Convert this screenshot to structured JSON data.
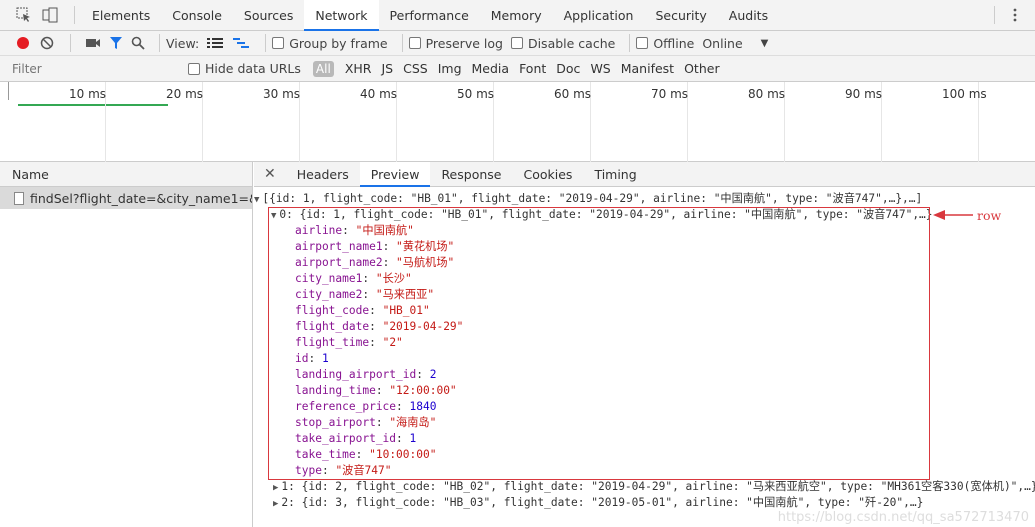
{
  "devtools": {
    "tabs": [
      "Elements",
      "Console",
      "Sources",
      "Network",
      "Performance",
      "Memory",
      "Application",
      "Security",
      "Audits"
    ],
    "active_tab": "Network"
  },
  "toolbar": {
    "view_label": "View:",
    "group_by_frame": "Group by frame",
    "preserve_log": "Preserve log",
    "disable_cache": "Disable cache",
    "offline": "Offline",
    "throttle_value": "Online"
  },
  "filter": {
    "placeholder": "Filter",
    "hide_data_urls": "Hide data URLs",
    "all": "All",
    "types": [
      "XHR",
      "JS",
      "CSS",
      "Img",
      "Media",
      "Font",
      "Doc",
      "WS",
      "Manifest",
      "Other"
    ]
  },
  "timeline": {
    "ticks": [
      "10 ms",
      "20 ms",
      "30 ms",
      "40 ms",
      "50 ms",
      "60 ms",
      "70 ms",
      "80 ms",
      "90 ms",
      "100 ms"
    ]
  },
  "requests": {
    "header": "Name",
    "items": [
      "findSel?flight_date=&city_name1=&cit..."
    ]
  },
  "detail": {
    "tabs": [
      "Headers",
      "Preview",
      "Response",
      "Cookies",
      "Timing"
    ],
    "active_tab": "Preview"
  },
  "preview": {
    "root_line": "[{id: 1, flight_code: \"HB_01\", flight_date: \"2019-04-29\", airline: \"中国南航\", type: \"波音747\",…},…]",
    "item0_summary": "0: {id: 1, flight_code: \"HB_01\", flight_date: \"2019-04-29\", airline: \"中国南航\", type: \"波音747\",…}",
    "fields": [
      {
        "key": "airline",
        "value": "\"中国南航\"",
        "kind": "s"
      },
      {
        "key": "airport_name1",
        "value": "\"黄花机场\"",
        "kind": "s"
      },
      {
        "key": "airport_name2",
        "value": "\"马航机场\"",
        "kind": "s"
      },
      {
        "key": "city_name1",
        "value": "\"长沙\"",
        "kind": "s"
      },
      {
        "key": "city_name2",
        "value": "\"马来西亚\"",
        "kind": "s"
      },
      {
        "key": "flight_code",
        "value": "\"HB_01\"",
        "kind": "s"
      },
      {
        "key": "flight_date",
        "value": "\"2019-04-29\"",
        "kind": "s"
      },
      {
        "key": "flight_time",
        "value": "\"2\"",
        "kind": "s"
      },
      {
        "key": "id",
        "value": "1",
        "kind": "n"
      },
      {
        "key": "landing_airport_id",
        "value": "2",
        "kind": "n"
      },
      {
        "key": "landing_time",
        "value": "\"12:00:00\"",
        "kind": "s"
      },
      {
        "key": "reference_price",
        "value": "1840",
        "kind": "n"
      },
      {
        "key": "stop_airport",
        "value": "\"海南岛\"",
        "kind": "s"
      },
      {
        "key": "take_airport_id",
        "value": "1",
        "kind": "n"
      },
      {
        "key": "take_time",
        "value": "\"10:00:00\"",
        "kind": "s"
      },
      {
        "key": "type",
        "value": "\"波音747\"",
        "kind": "s"
      }
    ],
    "item1_summary": "1: {id: 2, flight_code: \"HB_02\", flight_date: \"2019-04-29\", airline: \"马来西亚航空\", type: \"MH361空客330(宽体机)\",…}",
    "item2_summary": "2: {id: 3, flight_code: \"HB_03\", flight_date: \"2019-05-01\", airline: \"中国南航\", type: \"歼-20\",…}",
    "annotation_label": "row",
    "accent_color": "#d9383e"
  },
  "watermark": "https://blog.csdn.net/qq_sa572713470"
}
